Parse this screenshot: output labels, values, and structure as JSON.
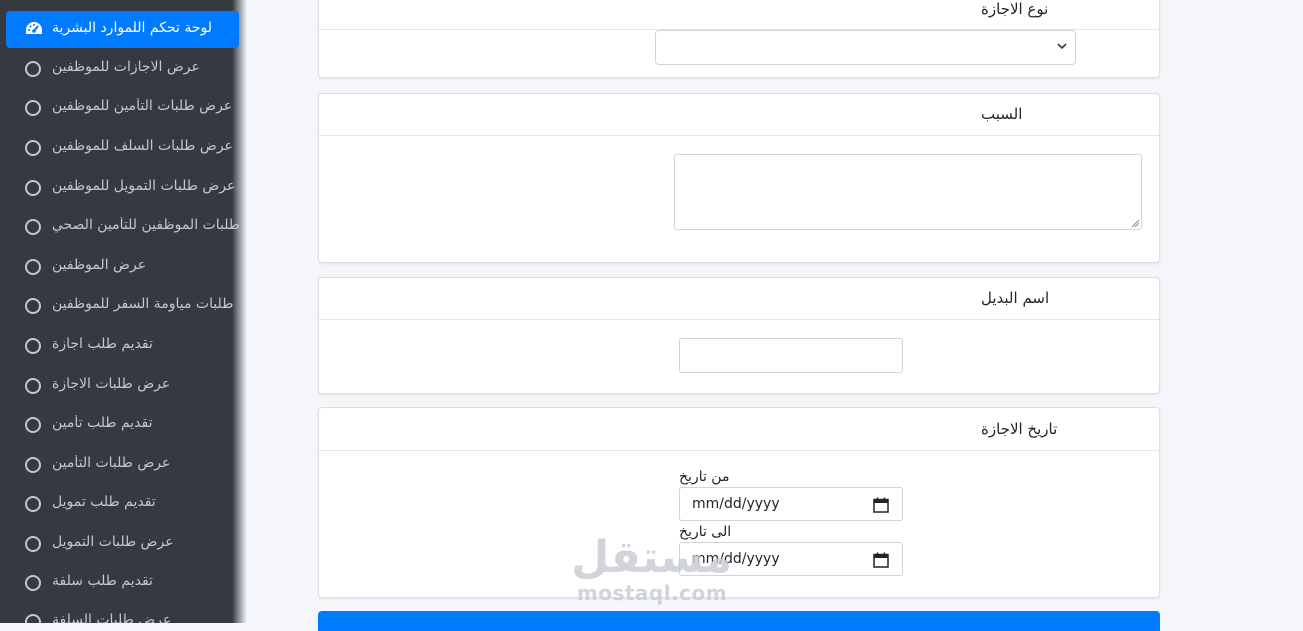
{
  "sidebar": {
    "active_item": {
      "label": "لوحة تحكم اللموارد البشرية",
      "icon": "tachometer-icon"
    },
    "items": [
      {
        "label": "عرض الاجازات للموظفين"
      },
      {
        "label": "عرض طلبات التأمين للموظفين"
      },
      {
        "label": "عرض طلبات السلف للموظفين"
      },
      {
        "label": "عرض طلبات التمويل للموظفين"
      },
      {
        "label": "طلبات الموظفين للتأمين الصحي"
      },
      {
        "label": "عرض الموظفين"
      },
      {
        "label": "طلبات مياومة السفر للموظفين"
      },
      {
        "label": "تقديم طلب اجازة"
      },
      {
        "label": "عرض طلبات الاجازة"
      },
      {
        "label": "تقديم طلب تأمين"
      },
      {
        "label": "عرض طلبات التأمين"
      },
      {
        "label": "تقديم طلب تمويل"
      },
      {
        "label": "عرض طلبات التمويل"
      },
      {
        "label": "تقديم طلب سلفة"
      },
      {
        "label": "عرض طلبات السلفة"
      }
    ],
    "colors": {
      "background": "#343a40",
      "active": "#007bff",
      "text": "#c2c7d0"
    }
  },
  "form": {
    "leave_type": {
      "title": "نوع الاجازة",
      "selected": ""
    },
    "reason": {
      "title": "السبب",
      "value": ""
    },
    "substitute": {
      "title": "اسم البديل",
      "value": ""
    },
    "leave_date": {
      "title": "تاريخ الاجازة",
      "from_label": "من تاريخ",
      "from_placeholder": "mm/dd/yyyy",
      "to_label": "الى تاريخ",
      "to_placeholder": "mm/dd/yyyy"
    },
    "submit_color": "#007bff"
  },
  "watermark": {
    "arabic": "مستقل",
    "latin": "mostaql.com"
  }
}
